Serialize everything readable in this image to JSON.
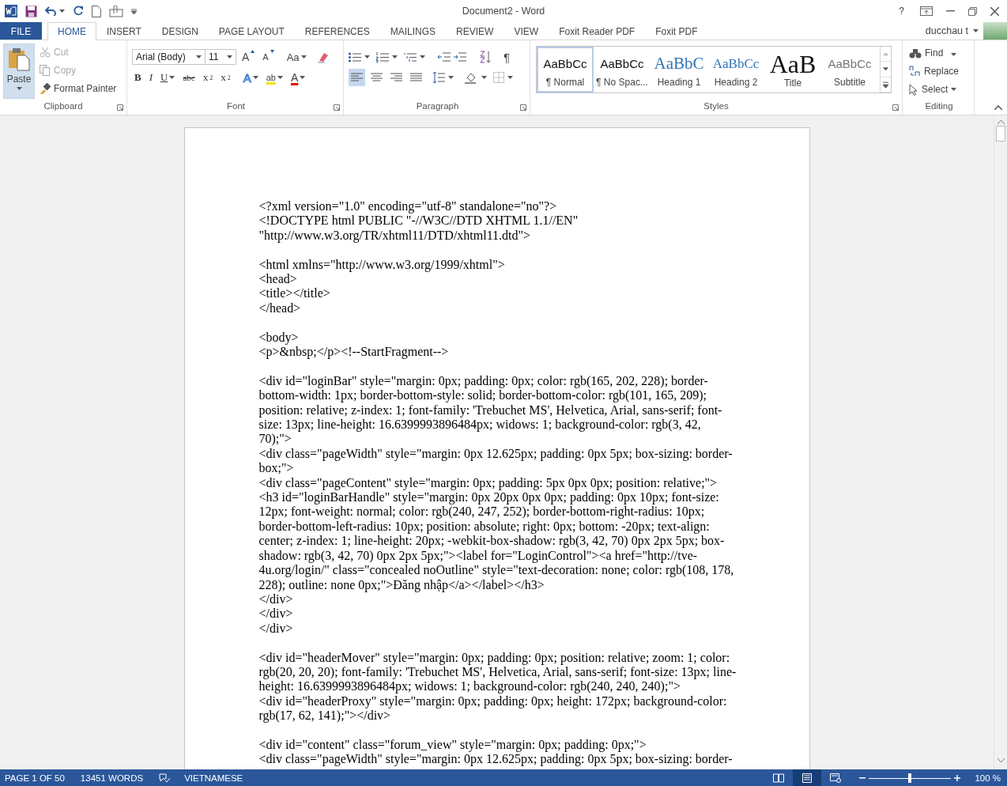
{
  "window": {
    "title": "Document2 - Word",
    "help": "?"
  },
  "tabs": [
    {
      "label": "FILE",
      "kind": "file",
      "selected": false
    },
    {
      "label": "HOME",
      "kind": "tab",
      "selected": true
    },
    {
      "label": "INSERT",
      "kind": "tab",
      "selected": false
    },
    {
      "label": "DESIGN",
      "kind": "tab",
      "selected": false
    },
    {
      "label": "PAGE LAYOUT",
      "kind": "tab",
      "selected": false
    },
    {
      "label": "REFERENCES",
      "kind": "tab",
      "selected": false
    },
    {
      "label": "MAILINGS",
      "kind": "tab",
      "selected": false
    },
    {
      "label": "REVIEW",
      "kind": "tab",
      "selected": false
    },
    {
      "label": "VIEW",
      "kind": "tab",
      "selected": false
    },
    {
      "label": "Foxit Reader PDF",
      "kind": "tab",
      "selected": false
    },
    {
      "label": "Foxit PDF",
      "kind": "tab",
      "selected": false
    }
  ],
  "account": {
    "name": "ducchau t"
  },
  "ribbon": {
    "clipboard": {
      "label": "Clipboard",
      "paste": "Paste",
      "cut": {
        "label": "Cut",
        "disabled": true
      },
      "copy": {
        "label": "Copy",
        "disabled": true
      },
      "format_painter": {
        "label": "Format Painter",
        "disabled": false
      }
    },
    "font": {
      "label": "Font",
      "font_name": "Arial (Body)",
      "font_size": "11",
      "grow": "A",
      "shrink": "A",
      "change_case": "Aa",
      "format_buttons": [
        "B",
        "I",
        "U",
        "abc"
      ],
      "subscript": "x",
      "subscript_mark": "2",
      "superscript": "x",
      "superscript_mark": "2",
      "text_effects": "A",
      "highlight": "ab",
      "font_color": "A"
    },
    "paragraph": {
      "label": "Paragraph",
      "pilcrow": "¶",
      "align_buttons": [
        {
          "kind": "left",
          "selected": true
        },
        {
          "kind": "center",
          "selected": false
        },
        {
          "kind": "right",
          "selected": false
        },
        {
          "kind": "justify",
          "selected": false
        }
      ]
    },
    "styles": {
      "label": "Styles",
      "items": [
        {
          "preview": "AaBbCc",
          "name": "¶ Normal",
          "kind": "normal",
          "selected": true
        },
        {
          "preview": "AaBbCc",
          "name": "¶ No Spac...",
          "kind": "normal",
          "selected": false
        },
        {
          "preview": "AaBbC",
          "name": "Heading 1",
          "kind": "heading1",
          "selected": false
        },
        {
          "preview": "AaBbCc",
          "name": "Heading 2",
          "kind": "heading2",
          "selected": false
        },
        {
          "preview": "AaB",
          "name": "Title",
          "kind": "title",
          "selected": false
        },
        {
          "preview": "AaBbCc",
          "name": "Subtitle",
          "kind": "subtitle",
          "selected": false
        }
      ]
    },
    "editing": {
      "label": "Editing",
      "find": "Find",
      "replace": "Replace",
      "select": "Select"
    }
  },
  "document": {
    "sections": [
      [
        "<?xml version=\"1.0\" encoding=\"utf-8\" standalone=\"no\"?>",
        "<!DOCTYPE html PUBLIC \"-//W3C//DTD XHTML 1.1//EN\" \"http://www.w3.org/TR/xhtml11/DTD/xhtml11.dtd\">"
      ],
      [
        "<html xmlns=\"http://www.w3.org/1999/xhtml\">",
        "<head>",
        "<title></title>",
        "</head>"
      ],
      [
        "<body>",
        "<p>&nbsp;</p><!--StartFragment-->"
      ],
      [
        "<div id=\"loginBar\" style=\"margin: 0px; padding: 0px; color: rgb(165, 202, 228); border-bottom-width: 1px; border-bottom-style: solid; border-bottom-color: rgb(101, 165, 209); position: relative; z-index: 1; font-family: 'Trebuchet MS', Helvetica, Arial, sans-serif; font-size: 13px; line-height: 16.6399993896484px; widows: 1; background-color: rgb(3, 42, 70);\">",
        "<div class=\"pageWidth\" style=\"margin: 0px 12.625px; padding: 0px 5px; box-sizing: border-box;\">",
        "<div class=\"pageContent\" style=\"margin: 0px; padding: 5px 0px 0px; position: relative;\">",
        "<h3 id=\"loginBarHandle\" style=\"margin: 0px 20px 0px 0px; padding: 0px 10px; font-size: 12px; font-weight: normal; color: rgb(240, 247, 252); border-bottom-right-radius: 10px; border-bottom-left-radius: 10px; position: absolute; right: 0px; bottom: -20px; text-align: center; z-index: 1; line-height: 20px; -webkit-box-shadow: rgb(3, 42, 70) 0px 2px 5px; box-shadow: rgb(3, 42, 70) 0px 2px 5px;\"><label for=\"LoginControl\"><a href=\"http://tve-4u.org/login/\" class=\"concealed noOutline\" style=\"text-decoration: none; color: rgb(108, 178, 228); outline: none 0px;\">Đăng nhập</a></label></h3>",
        "</div>",
        "</div>",
        "</div>"
      ],
      [
        "<div id=\"headerMover\" style=\"margin: 0px; padding: 0px; position: relative; zoom: 1; color: rgb(20, 20, 20); font-family: 'Trebuchet MS', Helvetica, Arial, sans-serif; font-size: 13px; line-height: 16.6399993896484px; widows: 1; background-color: rgb(240, 240, 240);\">",
        "<div id=\"headerProxy\" style=\"margin: 0px; padding: 0px; height: 172px; background-color: rgb(17, 62, 141);\"></div>"
      ],
      [
        "<div id=\"content\" class=\"forum_view\" style=\"margin: 0px; padding: 0px;\">",
        "<div class=\"pageWidth\" style=\"margin: 0px 12.625px; padding: 0px 5px; box-sizing: border-"
      ]
    ]
  },
  "status_bar": {
    "page": "PAGE 1 OF 50",
    "words": "13451 WORDS",
    "language": "VIETNAMESE",
    "views": [
      {
        "kind": "read",
        "selected": false
      },
      {
        "kind": "print",
        "selected": true
      },
      {
        "kind": "web",
        "selected": false
      }
    ],
    "zoom": {
      "level": 0.5,
      "reading": "100 %"
    }
  }
}
